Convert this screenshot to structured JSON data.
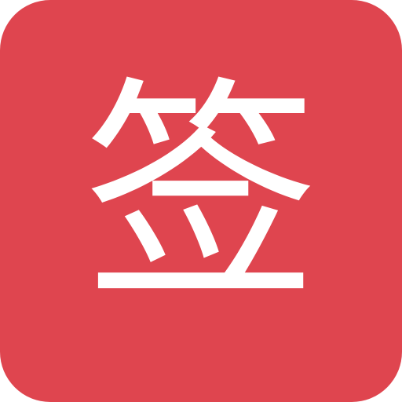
{
  "app_icon": {
    "character": "签",
    "colors": {
      "background": "#DF454F",
      "glyph": "#FFFFFF"
    }
  }
}
